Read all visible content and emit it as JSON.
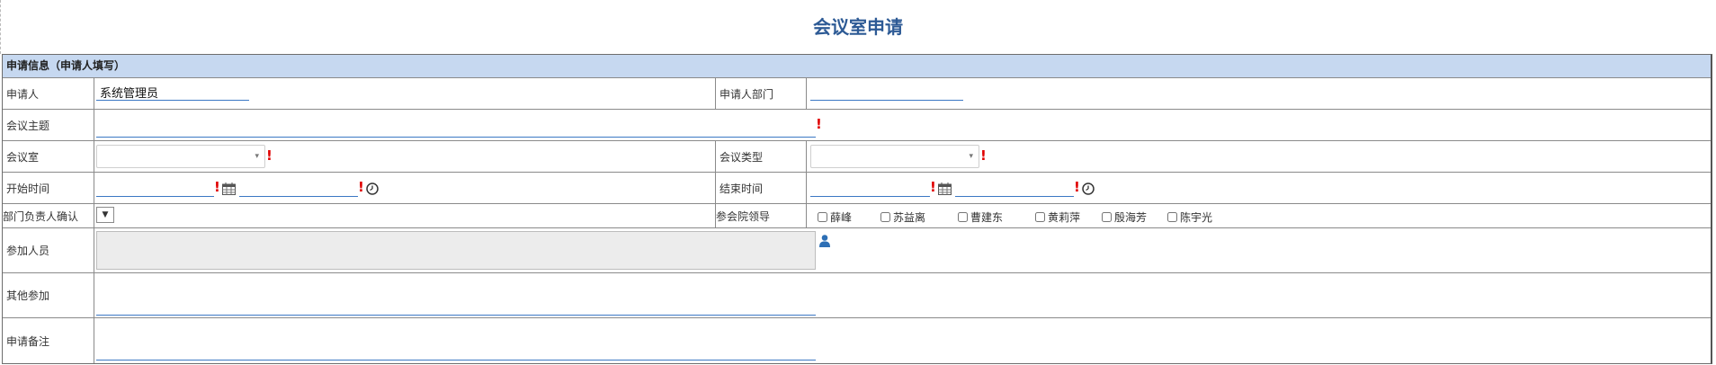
{
  "page": {
    "title": "会议室申请"
  },
  "section": {
    "title": "申请信息（申请人填写）"
  },
  "fields": {
    "applicant": {
      "label": "申请人",
      "value": "系统管理员"
    },
    "applicant_dept": {
      "label": "申请人部门",
      "value": ""
    },
    "meeting_subject": {
      "label": "会议主题",
      "value": ""
    },
    "meeting_room": {
      "label": "会议室",
      "value": ""
    },
    "meeting_type": {
      "label": "会议类型",
      "value": ""
    },
    "start_time": {
      "label": "开始时间",
      "date": "",
      "time": ""
    },
    "end_time": {
      "label": "结束时间",
      "date": "",
      "time": ""
    },
    "dept_head_confirm": {
      "label": "部门负责人确认",
      "value": ""
    },
    "leaders": {
      "label": "参会院领导",
      "options": [
        "薛峰",
        "苏益离",
        "曹建东",
        "黄莉萍",
        "殷海芳",
        "陈宇光"
      ]
    },
    "participants": {
      "label": "参加人员",
      "value": ""
    },
    "other_participants": {
      "label": "其他参加",
      "value": ""
    },
    "remarks": {
      "label": "申请备注",
      "value": ""
    }
  },
  "colors": {
    "section_bg": "#c6d8f0",
    "title": "#2d5a95",
    "required": "#e00000",
    "underline": "#3b78c4"
  },
  "icons": {
    "required": "!",
    "calendar": "calendar-icon",
    "clock": "clock-icon",
    "person": "person-icon",
    "dropdown": "▾"
  }
}
